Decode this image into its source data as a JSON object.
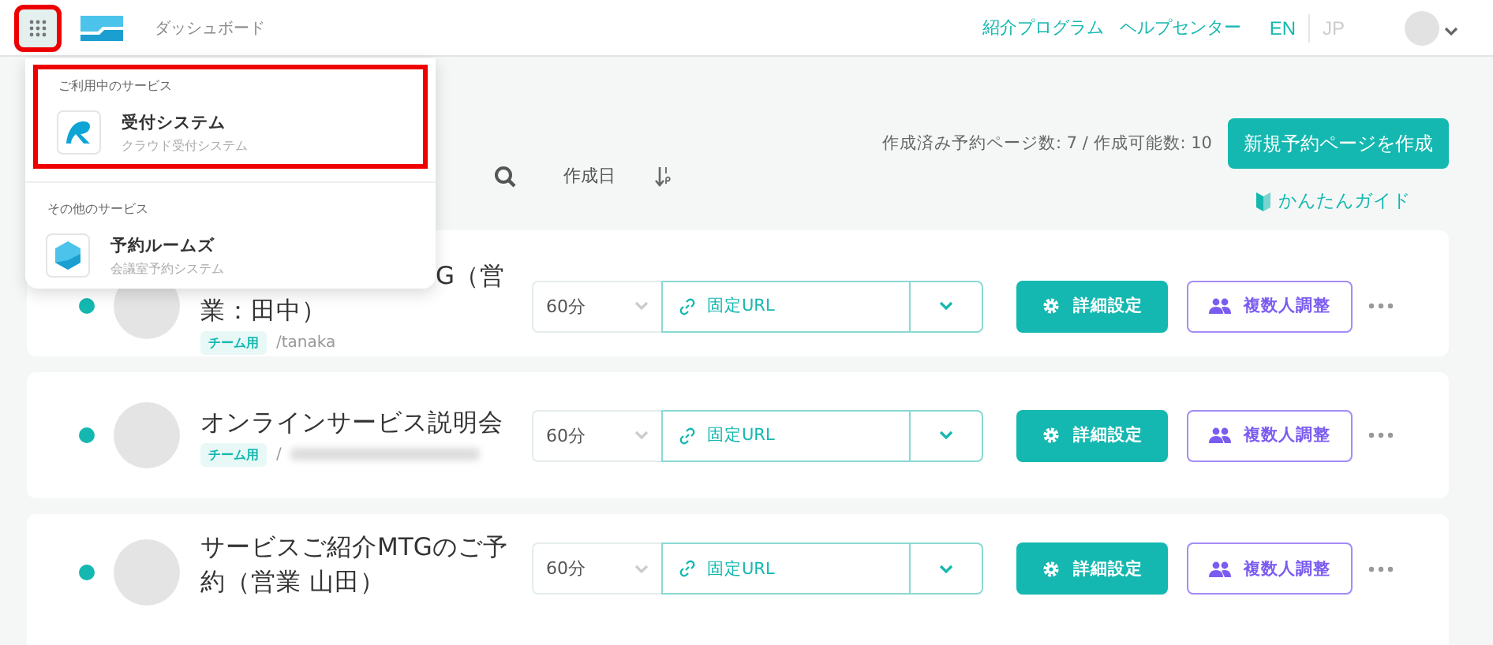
{
  "header": {
    "nav_label": "ダッシュボード",
    "links": [
      "紹介プログラム",
      "ヘルプセンター"
    ],
    "languages": [
      {
        "label": "EN",
        "selected": true
      },
      {
        "label": "JP",
        "selected": false
      }
    ]
  },
  "toolbar": {
    "sort_label": "作成日",
    "count_text": "作成済み予約ページ数: 7 / 作成可能数: 10",
    "create_button": "新規予約ページを作成",
    "guide_link": "かんたんガイド"
  },
  "cards": [
    {
      "kind": "partly_hidden",
      "title_lines": [
        "G（営",
        "業：田中）"
      ],
      "tag": "チーム用",
      "slug": "/tanaka",
      "slug_blurred": false,
      "duration": "60分",
      "url_label": "固定URL",
      "settings_button": "詳細設定",
      "multi_button": "複数人調整"
    },
    {
      "kind": "normal",
      "title_lines": [
        "オンラインサービス説明会"
      ],
      "tag": "チーム用",
      "slug": "/",
      "slug_blurred": true,
      "duration": "60分",
      "url_label": "固定URL",
      "settings_button": "詳細設定",
      "multi_button": "複数人調整"
    },
    {
      "kind": "normal",
      "title_lines": [
        "サービスご紹介MTGのご予",
        "約（営業 山田）"
      ],
      "duration": "60分",
      "url_label": "固定URL",
      "settings_button": "詳細設定",
      "multi_button": "複数人調整"
    }
  ],
  "service_menu": {
    "sections": [
      {
        "label": "ご利用中のサービス",
        "highlighted": true,
        "items": [
          {
            "kind": "reception",
            "name": "受付システム",
            "description": "クラウド受付システム"
          }
        ]
      },
      {
        "label": "その他のサービス",
        "highlighted": false,
        "items": [
          {
            "kind": "rooms",
            "name": "予約ルームズ",
            "description": "会議室予約システム"
          }
        ]
      }
    ]
  },
  "menu_button_highlighted": true
}
